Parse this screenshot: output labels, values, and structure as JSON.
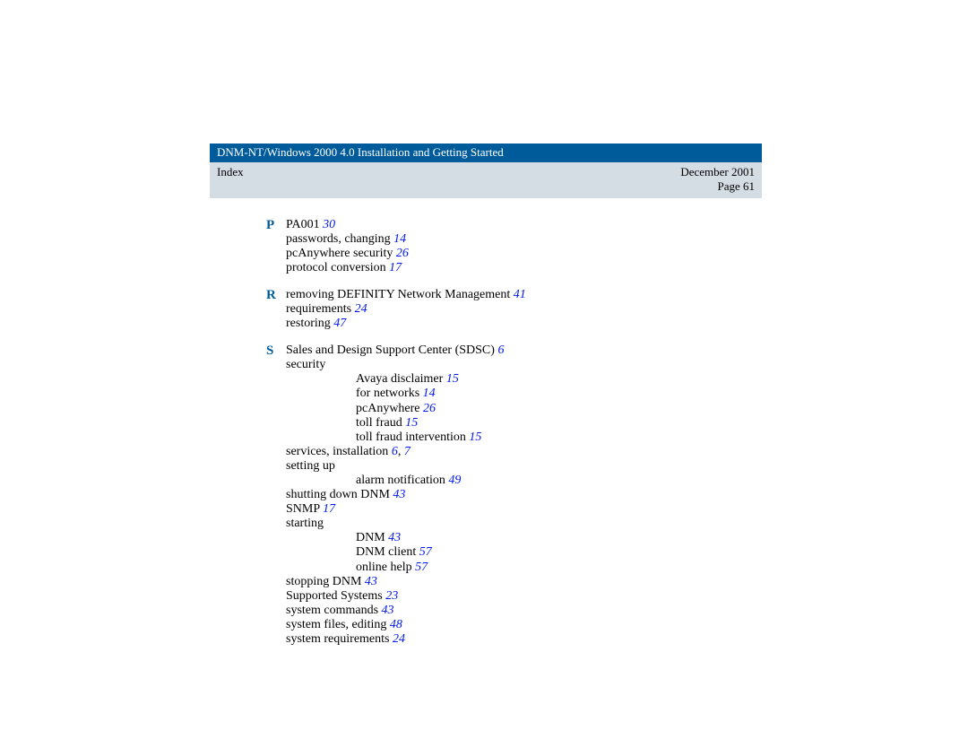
{
  "header": {
    "title": "DNM-NT/Windows 2000 4.0 Installation and Getting Started",
    "left": "Index",
    "date": "December 2001",
    "page": "Page 61"
  },
  "sections": [
    {
      "letter": "P",
      "entries": [
        {
          "text": "PA001",
          "refs": [
            "30"
          ]
        },
        {
          "text": "passwords, changing",
          "refs": [
            "14"
          ]
        },
        {
          "text": "pcAnywhere security",
          "refs": [
            "26"
          ]
        },
        {
          "text": "protocol conversion",
          "refs": [
            "17"
          ]
        }
      ]
    },
    {
      "letter": "R",
      "entries": [
        {
          "text": "removing DEFINITY Network Management",
          "refs": [
            "41"
          ]
        },
        {
          "text": "requirements",
          "refs": [
            "24"
          ]
        },
        {
          "text": "restoring",
          "refs": [
            "47"
          ]
        }
      ]
    },
    {
      "letter": "S",
      "entries": [
        {
          "text": "Sales and Design Support Center (SDSC)",
          "refs": [
            "6"
          ]
        },
        {
          "text": "security",
          "refs": []
        },
        {
          "text": "Avaya disclaimer",
          "refs": [
            "15"
          ],
          "sub": true
        },
        {
          "text": "for networks",
          "refs": [
            "14"
          ],
          "sub": true
        },
        {
          "text": "pcAnywhere",
          "refs": [
            "26"
          ],
          "sub": true
        },
        {
          "text": "toll fraud",
          "refs": [
            "15"
          ],
          "sub": true
        },
        {
          "text": "toll fraud intervention",
          "refs": [
            "15"
          ],
          "sub": true
        },
        {
          "text": "services, installation",
          "refs": [
            "6",
            "7"
          ]
        },
        {
          "text": "setting up",
          "refs": []
        },
        {
          "text": "alarm notification",
          "refs": [
            "49"
          ],
          "sub": true
        },
        {
          "text": "shutting down DNM",
          "refs": [
            "43"
          ]
        },
        {
          "text": "SNMP",
          "refs": [
            "17"
          ]
        },
        {
          "text": "starting",
          "refs": []
        },
        {
          "text": "DNM",
          "refs": [
            "43"
          ],
          "sub": true
        },
        {
          "text": "DNM client",
          "refs": [
            "57"
          ],
          "sub": true
        },
        {
          "text": "online help",
          "refs": [
            "57"
          ],
          "sub": true
        },
        {
          "text": "stopping DNM",
          "refs": [
            "43"
          ]
        },
        {
          "text": "Supported Systems",
          "refs": [
            "23"
          ]
        },
        {
          "text": "system commands",
          "refs": [
            "43"
          ]
        },
        {
          "text": "system files, editing",
          "refs": [
            "48"
          ]
        },
        {
          "text": "system requirements",
          "refs": [
            "24"
          ]
        }
      ]
    }
  ]
}
